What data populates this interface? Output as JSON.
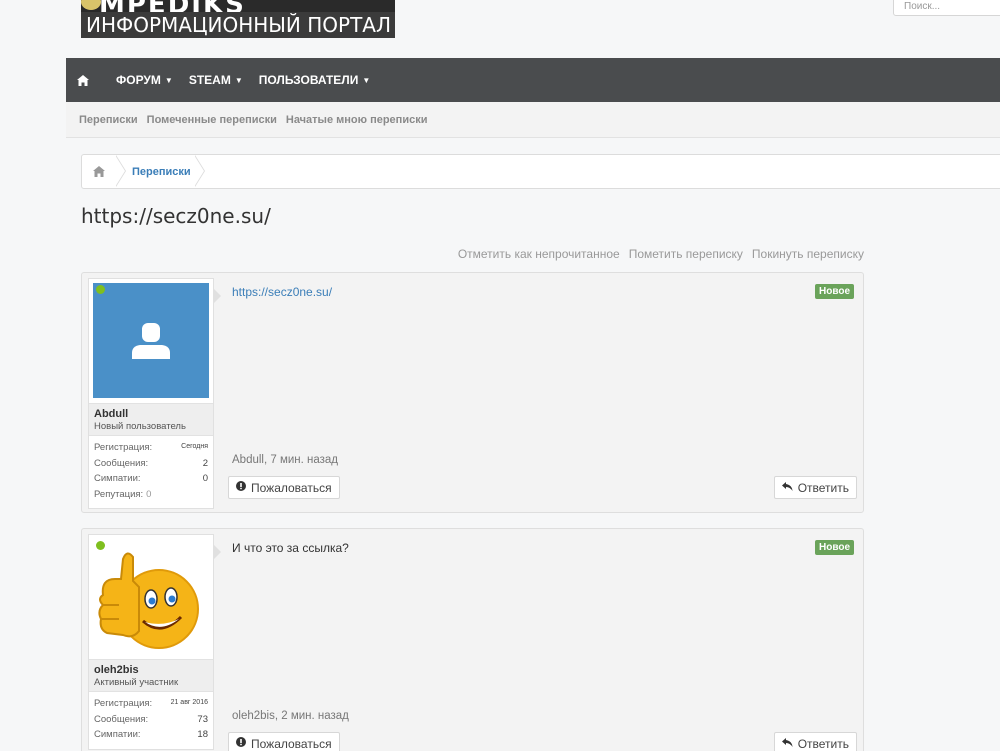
{
  "logo": {
    "top_text": "MPEDIKS",
    "bottom_text": "ИНФОРМАЦИОННЫЙ ПОРТАЛ"
  },
  "search": {
    "placeholder": "Поиск..."
  },
  "nav": {
    "items": [
      {
        "label": "ФОРУМ"
      },
      {
        "label": "STEAM"
      },
      {
        "label": "ПОЛЬЗОВАТЕЛИ"
      }
    ]
  },
  "subnav": {
    "items": [
      {
        "label": "Переписки"
      },
      {
        "label": "Помеченные переписки"
      },
      {
        "label": "Начатые мною переписки"
      }
    ]
  },
  "breadcrumb": {
    "current": "Переписки"
  },
  "page": {
    "title": "https://secz0ne.su/"
  },
  "actions": {
    "mark_unread": "Отметить как непрочитанное",
    "star": "Пометить переписку",
    "leave": "Покинуть переписку"
  },
  "messages": [
    {
      "user": {
        "name": "Abdull",
        "title": "Новый пользователь"
      },
      "stats": [
        {
          "label": "Регистрация:",
          "value": "Сегодня"
        },
        {
          "label": "Сообщения:",
          "value": "2"
        },
        {
          "label": "Симпатии:",
          "value": "0"
        },
        {
          "label": "Репутация:",
          "value": "0"
        }
      ],
      "body": "https://secz0ne.su/",
      "badge": "Новое",
      "meta": "Abdull, 7 мин. назад",
      "report": "Пожаловаться",
      "reply": "Ответить"
    },
    {
      "user": {
        "name": "oleh2bis",
        "title": "Активный участник"
      },
      "stats": [
        {
          "label": "Регистрация:",
          "value": "21 авг 2016"
        },
        {
          "label": "Сообщения:",
          "value": "73"
        },
        {
          "label": "Симпатии:",
          "value": "18"
        }
      ],
      "body": "И что это за ссылка?",
      "badge": "Новое",
      "meta": "oleh2bis, 2 мин. назад",
      "report": "Пожаловаться",
      "reply": "Ответить"
    }
  ],
  "colors": {
    "accent": "#3b7eb8",
    "navbar": "#4a4c4e",
    "badge": "#6aa35a",
    "online": "#7fbf1f"
  }
}
